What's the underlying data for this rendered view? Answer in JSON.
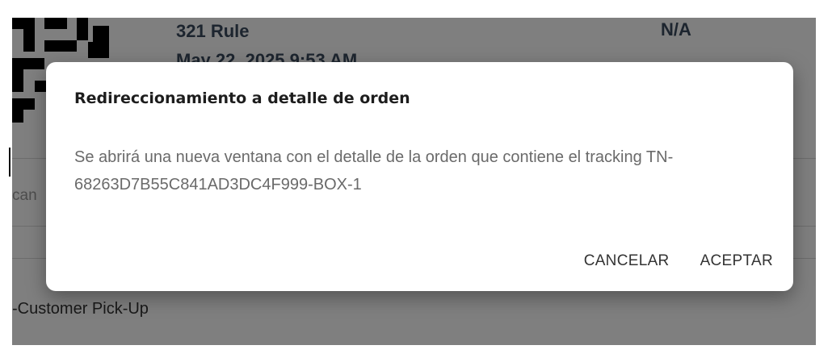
{
  "background": {
    "rule_title": "321 Rule",
    "rule_date": "May 22, 2025 9:53 AM",
    "status_value": "N/A",
    "scan_text": "can",
    "pickup_text": "-Customer Pick-Up"
  },
  "dialog": {
    "title": "Redireccionamiento a detalle de orden",
    "body": "Se abrirá una nueva ventana con el detalle de la orden que contiene el tracking TN-68263D7B55C841AD3DC4F999-BOX-1",
    "cancel_label": "CANCELAR",
    "accept_label": "ACEPTAR"
  },
  "colors": {
    "overlay": "#000000",
    "dialog_bg": "#ffffff",
    "title_text": "#1d1d1d",
    "body_text": "#6a6a6a"
  }
}
